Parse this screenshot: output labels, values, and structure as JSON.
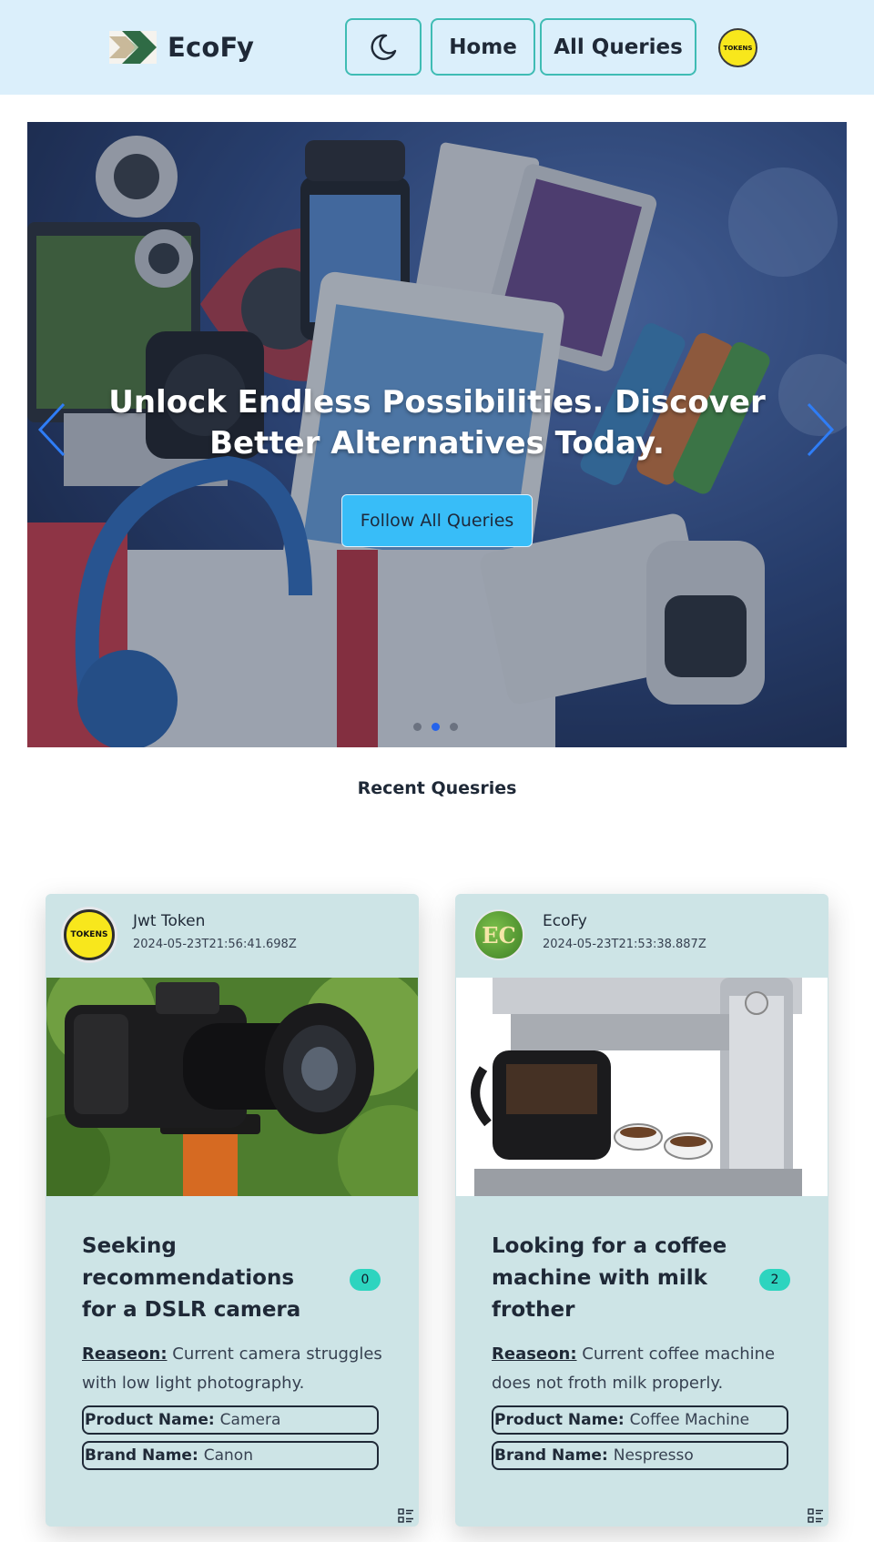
{
  "navbar": {
    "brand_name": "EcoFy",
    "theme_icon": "moon-icon",
    "home_label": "Home",
    "all_queries_label": "All Queries",
    "token_badge": "TOKENS"
  },
  "hero": {
    "title": "Unlock Endless Possibilities. Discover Better Alternatives Today.",
    "button_label": "Follow All Queries",
    "slides": 3,
    "active_slide": 2,
    "prev_icon": "chevron-left-icon",
    "next_icon": "chevron-right-icon"
  },
  "section_title": "Recent Quesries",
  "queries": [
    {
      "poster": "Jwt Token",
      "avatar_text": "TOKENS",
      "date": "2024-05-23T21:56:41.698Z",
      "image": "dslr-camera-photo",
      "title": "Seeking recommendations for a DSLR camera",
      "count": "0",
      "reason_label": "Reaseon:",
      "reason": "Current camera struggles with low light photography.",
      "product_label": "Product Name:",
      "product": "Camera",
      "brand_label": "Brand Name:",
      "brand": "Canon",
      "footer_icon": "list-details-icon"
    },
    {
      "poster": "EcoFy",
      "avatar_text": "EC",
      "date": "2024-05-23T21:53:38.887Z",
      "image": "coffee-machine-photo",
      "title": "Looking for a coffee machine with milk frother",
      "count": "2",
      "reason_label": "Reaseon:",
      "reason": "Current coffee machine does not froth milk properly.",
      "product_label": "Product Name:",
      "product": "Coffee Machine",
      "brand_label": "Brand Name:",
      "brand": "Nespresso",
      "footer_icon": "list-details-icon"
    }
  ]
}
